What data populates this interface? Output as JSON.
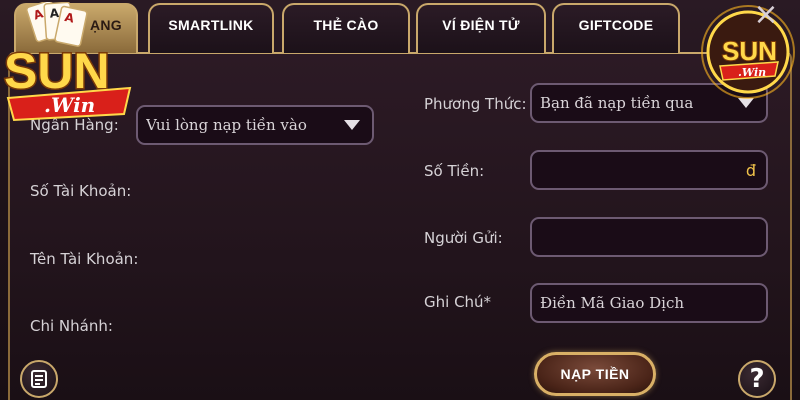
{
  "tabs": [
    {
      "label": "NẠP NGÂN HÀNG",
      "visible_label": "ẠNG"
    },
    {
      "label": "SMARTLINK"
    },
    {
      "label": "THẺ CÀO"
    },
    {
      "label": "VÍ ĐIỆN TỬ"
    },
    {
      "label": "GIFTCODE"
    }
  ],
  "logo": {
    "brand_text": "SUN",
    "sub_text": ".Win"
  },
  "left": {
    "bank_label": "Ngân Hàng:",
    "bank_select_value": "Vui lòng nạp tiền vào",
    "account_number_label": "Số Tài Khoản:",
    "account_name_label": "Tên Tài Khoản:",
    "branch_label": "Chi Nhánh:"
  },
  "right": {
    "method_label": "Phương Thức:",
    "method_select_value": "Bạn đã nạp tiền qua",
    "amount_label": "Số Tiền:",
    "currency_symbol": "đ",
    "sender_label": "Người Gửi:",
    "note_label": "Ghi Chú*",
    "note_placeholder": "Điền Mã Giao Dịch"
  },
  "submit_label": "NẠP TIỀN",
  "close_glyph": "×",
  "help_glyph": "?",
  "colors": {
    "gold": "#c9a86b",
    "accent_yellow": "#f0c24a",
    "field_bg": "#1a0c17"
  }
}
